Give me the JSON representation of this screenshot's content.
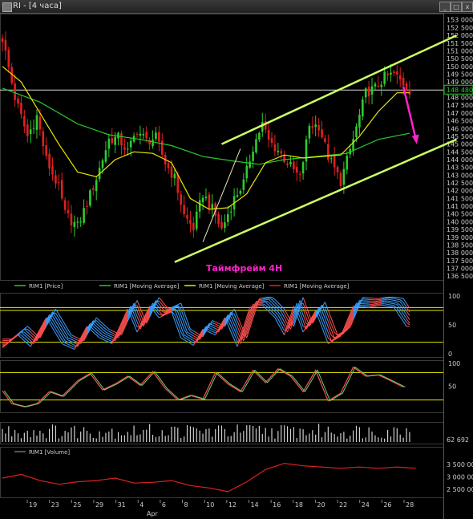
{
  "window": {
    "title": "RI - [4 часа]",
    "btn_minimize": "_",
    "btn_maximize": "□",
    "btn_close": "x"
  },
  "colors": {
    "up": "#2ecc2e",
    "down": "#e02020",
    "ma_fast": "#e8e800",
    "ma_slow": "#28c828",
    "channel": "#ccff66",
    "arrow": "#ff22cc",
    "stoch_red": "#ff5050",
    "stoch_blue": "#3aa0ff",
    "level": "#e8e800",
    "volume_line": "#e02020"
  },
  "annotation": {
    "text": "Таймфрейм 4Н"
  },
  "chart_data": {
    "type": "candlestick",
    "price_axis": {
      "ticks": [
        "153 000",
        "152 500",
        "152 000",
        "151 500",
        "151 000",
        "150 500",
        "150 000",
        "149 500",
        "149 000",
        "148 500",
        "148 000",
        "147 500",
        "147 000",
        "146 500",
        "146 000",
        "145 500",
        "145 000",
        "144 500",
        "144 000",
        "143 500",
        "143 000",
        "142 500",
        "142 000",
        "141 500",
        "141 000",
        "140 500",
        "140 000",
        "139 500",
        "139 000",
        "138 500",
        "138 000",
        "137 500",
        "137 000",
        "136 500"
      ],
      "current_price": "148 480",
      "range": [
        136250,
        153400
      ]
    },
    "x_axis": {
      "ticks": [
        "19",
        "23",
        "25",
        "29",
        "31",
        "4",
        "6",
        "8",
        "10",
        "12",
        "14",
        "16",
        "18",
        "20",
        "22",
        "24",
        "26",
        "28"
      ],
      "month_label": "Apr"
    },
    "legend": [
      "RIM1 [Price]",
      "RIM1 [Moving Average]",
      "RIM1 [Moving Average]",
      "RIM1 [Moving Average]"
    ],
    "close_path": [
      [
        0,
        151800
      ],
      [
        4,
        148000
      ],
      [
        8,
        145500
      ],
      [
        11,
        146800
      ],
      [
        14,
        144000
      ],
      [
        18,
        142200
      ],
      [
        20,
        140500
      ],
      [
        24,
        139700
      ],
      [
        27,
        141200
      ],
      [
        30,
        142800
      ],
      [
        34,
        145300
      ],
      [
        37,
        145400
      ],
      [
        40,
        144500
      ],
      [
        43,
        145900
      ],
      [
        46,
        145200
      ],
      [
        49,
        145400
      ],
      [
        52,
        143800
      ],
      [
        55,
        142800
      ],
      [
        58,
        140400
      ],
      [
        61,
        139600
      ],
      [
        64,
        141800
      ],
      [
        67,
        140800
      ],
      [
        70,
        139500
      ],
      [
        74,
        141500
      ],
      [
        77,
        142500
      ],
      [
        80,
        144800
      ],
      [
        83,
        146300
      ],
      [
        85,
        145200
      ],
      [
        88,
        144600
      ],
      [
        91,
        143800
      ],
      [
        95,
        142800
      ],
      [
        98,
        146200
      ],
      [
        101,
        146200
      ],
      [
        104,
        144200
      ],
      [
        108,
        142600
      ],
      [
        112,
        145300
      ],
      [
        116,
        148300
      ],
      [
        119,
        148600
      ],
      [
        122,
        149300
      ],
      [
        125,
        149500
      ],
      [
        128,
        148900
      ],
      [
        130,
        148480
      ]
    ],
    "fast_ma": [
      [
        0,
        150000
      ],
      [
        6,
        149000
      ],
      [
        12,
        147000
      ],
      [
        18,
        145000
      ],
      [
        24,
        143200
      ],
      [
        30,
        142900
      ],
      [
        36,
        144000
      ],
      [
        42,
        144500
      ],
      [
        48,
        144400
      ],
      [
        54,
        143800
      ],
      [
        60,
        141500
      ],
      [
        66,
        140800
      ],
      [
        72,
        140900
      ],
      [
        78,
        141800
      ],
      [
        84,
        143800
      ],
      [
        90,
        144300
      ],
      [
        96,
        144100
      ],
      [
        102,
        144200
      ],
      [
        108,
        144300
      ],
      [
        114,
        145500
      ],
      [
        120,
        147100
      ],
      [
        126,
        148300
      ],
      [
        130,
        148300
      ]
    ],
    "slow_ma": [
      [
        0,
        148600
      ],
      [
        12,
        147700
      ],
      [
        24,
        146300
      ],
      [
        34,
        145600
      ],
      [
        44,
        145300
      ],
      [
        54,
        144900
      ],
      [
        64,
        144200
      ],
      [
        74,
        143900
      ],
      [
        82,
        143700
      ],
      [
        90,
        144000
      ],
      [
        100,
        144200
      ],
      [
        110,
        144400
      ],
      [
        120,
        145300
      ],
      [
        130,
        145700
      ]
    ],
    "channel_upper": [
      [
        70,
        145000
      ],
      [
        145,
        152000
      ]
    ],
    "channel_lower": [
      [
        55,
        137400
      ],
      [
        145,
        145300
      ]
    ],
    "trend_line": [
      [
        64,
        138700
      ],
      [
        76,
        144700
      ]
    ],
    "forecast_arrow": [
      [
        128,
        148700
      ],
      [
        132,
        145100
      ]
    ],
    "stochastic_panel": {
      "ticks": [
        "100",
        "50",
        "0"
      ],
      "levels": [
        80,
        75,
        20
      ],
      "curve": [
        [
          0,
          18
        ],
        [
          5,
          40
        ],
        [
          9,
          20
        ],
        [
          14,
          70
        ],
        [
          19,
          25
        ],
        [
          23,
          15
        ],
        [
          27,
          55
        ],
        [
          31,
          35
        ],
        [
          35,
          25
        ],
        [
          40,
          85
        ],
        [
          43,
          45
        ],
        [
          47,
          90
        ],
        [
          50,
          70
        ],
        [
          54,
          80
        ],
        [
          57,
          35
        ],
        [
          61,
          22
        ],
        [
          64,
          50
        ],
        [
          68,
          40
        ],
        [
          71,
          70
        ],
        [
          75,
          20
        ],
        [
          79,
          88
        ],
        [
          83,
          92
        ],
        [
          87,
          70
        ],
        [
          90,
          40
        ],
        [
          93,
          90
        ],
        [
          96,
          45
        ],
        [
          100,
          82
        ],
        [
          104,
          25
        ],
        [
          108,
          38
        ],
        [
          112,
          90
        ],
        [
          117,
          88
        ],
        [
          121,
          92
        ],
        [
          125,
          88
        ],
        [
          129,
          55
        ]
      ]
    },
    "oscillator_panel": {
      "ticks": [
        "100",
        "50"
      ],
      "levels": [
        80,
        20
      ],
      "curve": [
        [
          0,
          40
        ],
        [
          3,
          12
        ],
        [
          7,
          5
        ],
        [
          11,
          12
        ],
        [
          15,
          38
        ],
        [
          19,
          28
        ],
        [
          24,
          62
        ],
        [
          28,
          78
        ],
        [
          32,
          42
        ],
        [
          36,
          55
        ],
        [
          40,
          72
        ],
        [
          44,
          52
        ],
        [
          48,
          82
        ],
        [
          52,
          45
        ],
        [
          56,
          20
        ],
        [
          60,
          30
        ],
        [
          64,
          22
        ],
        [
          68,
          80
        ],
        [
          72,
          55
        ],
        [
          76,
          38
        ],
        [
          80,
          85
        ],
        [
          84,
          58
        ],
        [
          88,
          88
        ],
        [
          92,
          72
        ],
        [
          96,
          38
        ],
        [
          100,
          85
        ],
        [
          104,
          18
        ],
        [
          108,
          35
        ],
        [
          112,
          92
        ],
        [
          116,
          72
        ],
        [
          120,
          75
        ],
        [
          124,
          62
        ],
        [
          128,
          48
        ]
      ]
    },
    "volume_histogram": {
      "value_label": "62 692"
    },
    "volume_panel": {
      "legend": "RIM1 [Volume]",
      "ticks": [
        "3 500 000",
        "3 000 000",
        "2 500 000"
      ],
      "curve": [
        [
          0,
          2.95
        ],
        [
          6,
          3.1
        ],
        [
          12,
          2.85
        ],
        [
          18,
          2.7
        ],
        [
          24,
          2.8
        ],
        [
          30,
          2.85
        ],
        [
          36,
          2.95
        ],
        [
          42,
          2.75
        ],
        [
          48,
          2.78
        ],
        [
          54,
          2.85
        ],
        [
          60,
          2.65
        ],
        [
          66,
          2.55
        ],
        [
          72,
          2.4
        ],
        [
          78,
          2.8
        ],
        [
          84,
          3.3
        ],
        [
          90,
          3.55
        ],
        [
          96,
          3.45
        ],
        [
          102,
          3.4
        ],
        [
          108,
          3.35
        ],
        [
          114,
          3.4
        ],
        [
          120,
          3.35
        ],
        [
          126,
          3.4
        ],
        [
          132,
          3.35
        ]
      ]
    }
  }
}
